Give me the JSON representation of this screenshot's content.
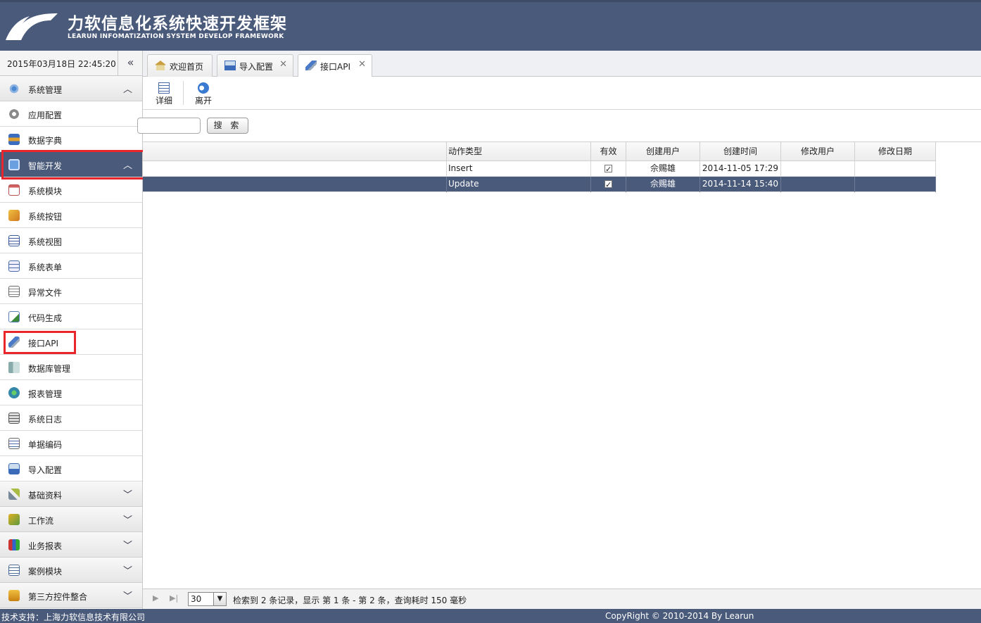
{
  "header": {
    "title": "力软信息化系统快速开发框架",
    "subtitle": "LEARUN INFOMATIZATION SYSTEM DEVELOP FRAMEWORK"
  },
  "sidebar": {
    "datetime": "2015年03月18日 22:45:20",
    "collapse_glyph": "«",
    "groups": [
      {
        "label": "系统管理",
        "icon": "gear-group-icon",
        "expanded": true
      },
      {
        "label": "智能开发",
        "icon": "monitor-icon",
        "expanded": true
      },
      {
        "label": "基础资料",
        "icon": "tools-icon",
        "expanded": false
      },
      {
        "label": "工作流",
        "icon": "workflow-icon",
        "expanded": false
      },
      {
        "label": "业务报表",
        "icon": "report-icon",
        "expanded": false
      },
      {
        "label": "案例模块",
        "icon": "case-icon",
        "expanded": false
      },
      {
        "label": "第三方控件整合",
        "icon": "plugin-icon",
        "expanded": false
      }
    ],
    "sys_items": [
      "应用配置",
      "数据字典"
    ],
    "dev_items": [
      "系统模块",
      "系统按钮",
      "系统视图",
      "系统表单",
      "异常文件",
      "代码生成",
      "接口API",
      "数据库管理",
      "报表管理",
      "系统日志",
      "单据编码",
      "导入配置"
    ]
  },
  "tabs": [
    {
      "label": "欢迎首页",
      "closable": false
    },
    {
      "label": "导入配置",
      "closable": true
    },
    {
      "label": "接口API",
      "closable": true,
      "active": true
    }
  ],
  "toolbar": {
    "detail": "详细",
    "leave": "离开"
  },
  "search": {
    "button": "搜 索"
  },
  "grid": {
    "columns": [
      "动作类型",
      "有效",
      "创建用户",
      "创建时间",
      "修改用户",
      "修改日期"
    ],
    "rows": [
      {
        "action": "Insert",
        "valid": true,
        "creator": "佘赐雄",
        "created": "2014-11-05 17:29",
        "modifier": "",
        "modified": ""
      },
      {
        "action": "Update",
        "valid": true,
        "creator": "佘赐雄",
        "created": "2014-11-14 15:40",
        "modifier": "",
        "modified": ""
      }
    ]
  },
  "pager": {
    "page_size": "30",
    "info": "检索到 2 条记录，显示 第 1 条 - 第 2 条，查询耗时 150 毫秒"
  },
  "footer": {
    "left": "技术支持：上海力软信息技术有限公司",
    "right": "CopyRight © 2010-2014 By Learun"
  },
  "colors": {
    "brand": "#4a5a7a",
    "highlight": "#e8262b"
  }
}
